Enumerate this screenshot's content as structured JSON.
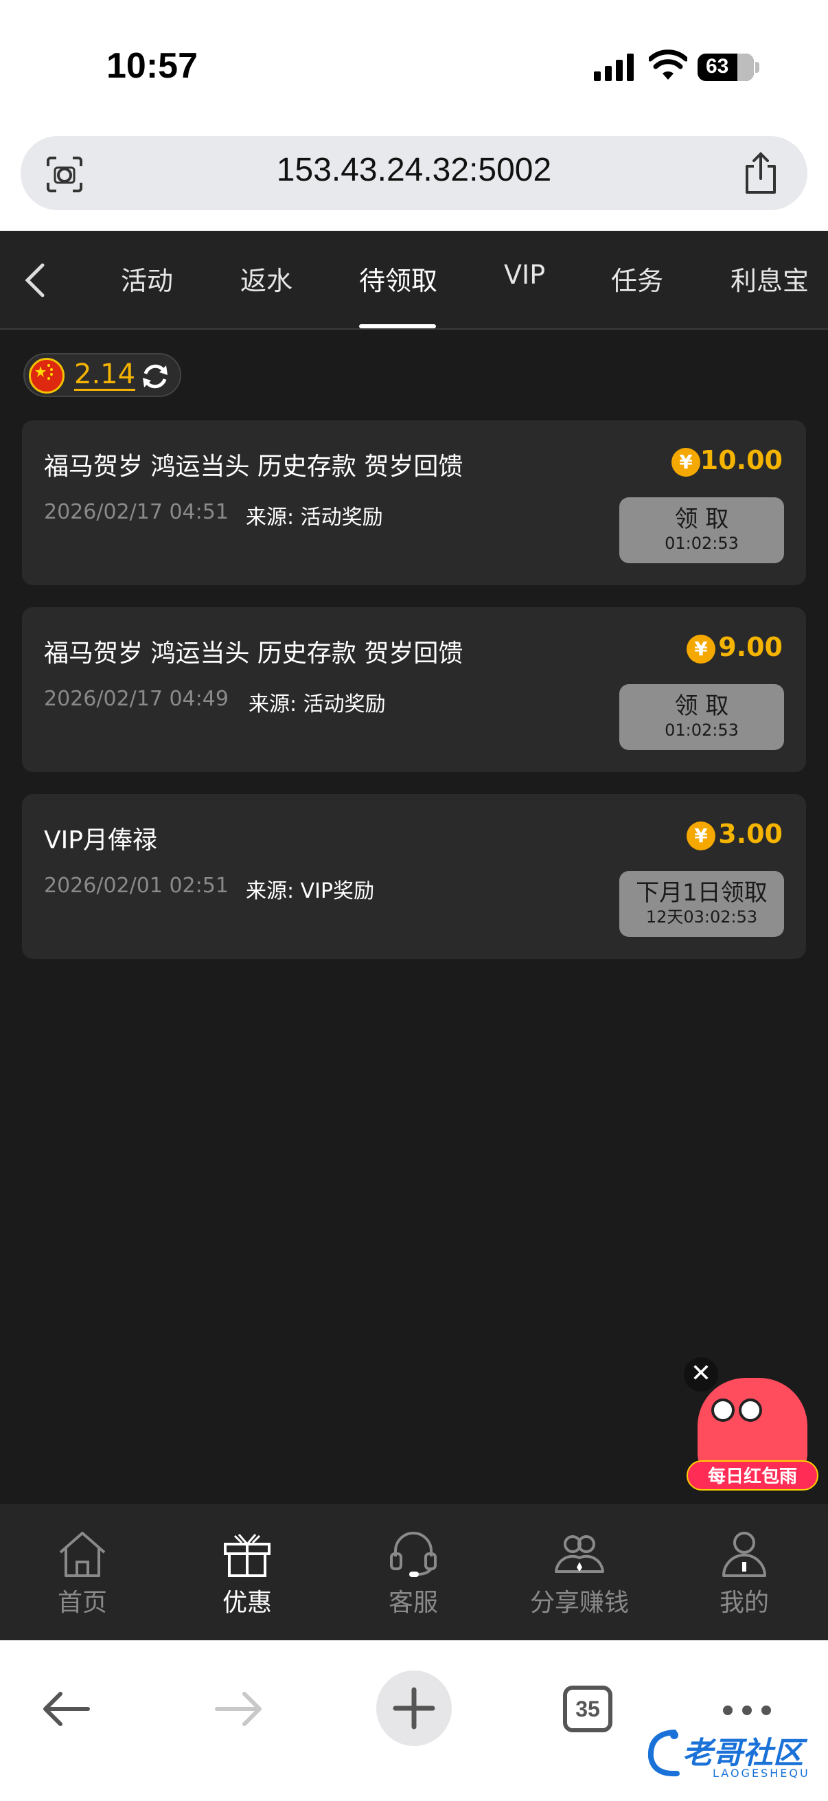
{
  "status_bar": {
    "time": "10:57",
    "battery": "63"
  },
  "browser": {
    "url": "153.43.24.32:5002",
    "tab_count": "35"
  },
  "tabs": [
    {
      "label": "活动"
    },
    {
      "label": "返水"
    },
    {
      "label": "待领取",
      "active": true
    },
    {
      "label": "VIP"
    },
    {
      "label": "任务"
    },
    {
      "label": "利息宝"
    }
  ],
  "balance": {
    "amount": "2.14"
  },
  "cards": [
    {
      "title": "福马贺岁 鸿运当头 历史存款 贺岁回馈",
      "date": "2026/02/17 04:51",
      "source": "来源: 活动奖励",
      "amount": "10.00",
      "button_main": "领 取",
      "button_sub": "01:02:53"
    },
    {
      "title": "福马贺岁 鸿运当头 历史存款 贺岁回馈",
      "date": "2026/02/17 04:49",
      "source": "来源: 活动奖励",
      "amount": "9.00",
      "button_main": "领 取",
      "button_sub": "01:02:53"
    },
    {
      "title": "VIP月俸禄",
      "date": "2026/02/01 02:51",
      "source": "来源: VIP奖励",
      "amount": "3.00",
      "button_main": "下月1日领取",
      "button_sub": "12天03:02:53"
    }
  ],
  "currency_symbol": "¥",
  "floating": {
    "label": "每日红包雨",
    "close": "✕"
  },
  "bottom_nav": [
    {
      "label": "首页",
      "icon": "home-icon"
    },
    {
      "label": "优惠",
      "icon": "gift-icon",
      "active": true
    },
    {
      "label": "客服",
      "icon": "headset-icon"
    },
    {
      "label": "分享赚钱",
      "icon": "share-users-icon"
    },
    {
      "label": "我的",
      "icon": "user-icon"
    }
  ],
  "watermark": {
    "text": "老哥社区",
    "sub": "LAOGESHEQU"
  },
  "colors": {
    "accent": "#f5b400",
    "background": "#1b1b1b",
    "card": "#2a2a2a"
  }
}
